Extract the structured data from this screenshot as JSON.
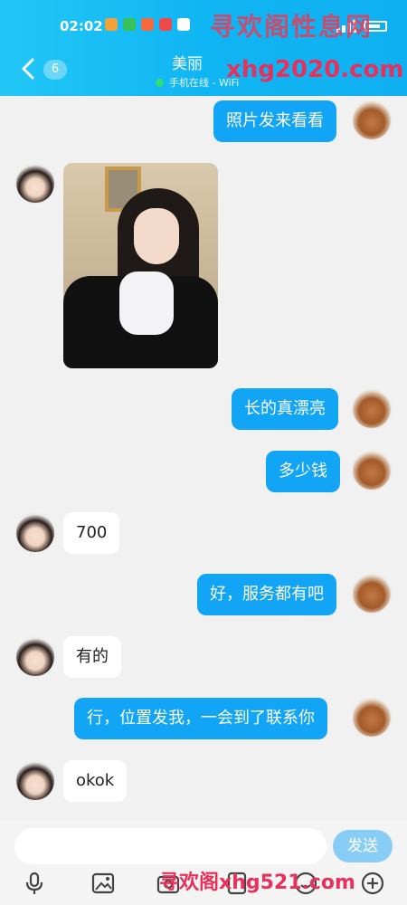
{
  "status_bar": {
    "time": "02:02"
  },
  "header": {
    "unread_count": "6",
    "contact_name": "美丽",
    "online_status": "手机在线 - WiFi"
  },
  "watermarks": {
    "top": "寻欢阁性息网",
    "url": "xhg2020.com",
    "bottom": "寻欢阁xhg521.com"
  },
  "messages": [
    {
      "from": "me",
      "text": "照片发来看看"
    },
    {
      "from": "her",
      "type": "image"
    },
    {
      "from": "me",
      "text": "长的真漂亮"
    },
    {
      "from": "me",
      "text": "多少钱"
    },
    {
      "from": "her",
      "text": "700"
    },
    {
      "from": "me",
      "text": "好，服务都有吧"
    },
    {
      "from": "her",
      "text": "有的"
    },
    {
      "from": "me",
      "text": "行，位置发我，一会到了联系你"
    },
    {
      "from": "her",
      "text": "okok"
    }
  ],
  "input": {
    "placeholder": "",
    "send_label": "发送"
  },
  "colors": {
    "header": "#14b6f3",
    "my_bubble": "#12a4f5",
    "send_button": "#88cdf6"
  },
  "toolbar_icons": [
    "microphone-icon",
    "image-icon",
    "camera-icon",
    "red-packet-icon",
    "emoji-icon",
    "plus-icon"
  ]
}
